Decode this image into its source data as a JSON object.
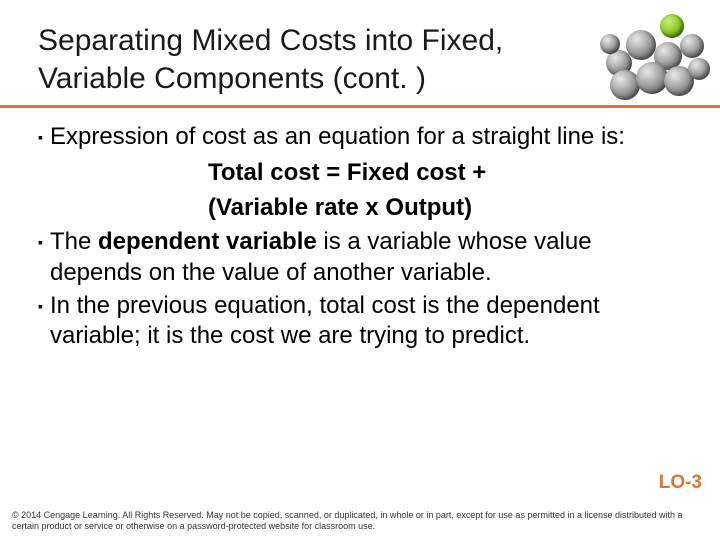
{
  "title": "Separating Mixed Costs into Fixed, Variable Components (cont. )",
  "bullets": {
    "b1_pre": "Expression of cost as an equation for a straight line is:",
    "eq1": "Total cost = Fixed cost +",
    "eq2": "(Variable rate x Output)",
    "b2_pre": "The ",
    "b2_bold": "dependent variable",
    "b2_post": " is a variable whose value depends on the value of another variable.",
    "b3": "In the previous equation, total cost is the dependent variable; it is the cost we are trying to predict."
  },
  "lo": "LO-3",
  "footer": "© 2014 Cengage Learning. All Rights Reserved. May not be copied, scanned, or duplicated, in whole or in part, except for use as permitted in a license distributed with a certain product or service or otherwise on a password-protected website for classroom use."
}
